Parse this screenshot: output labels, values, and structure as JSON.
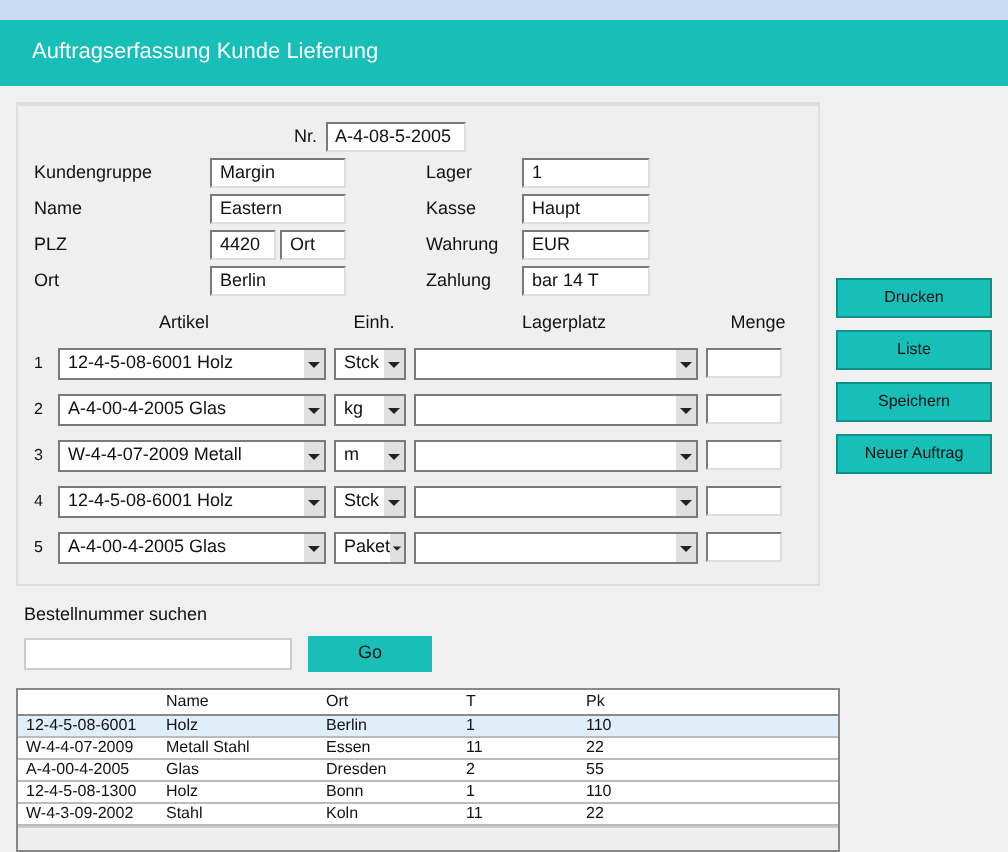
{
  "window": {
    "title": "Auftragserfassung Kunde Lieferung"
  },
  "order": {
    "label": "Nr.",
    "value": "A-4-08-5-2005"
  },
  "fields": [
    {
      "label": "Kundengruppe",
      "value": "Margin",
      "label_2": "Lager",
      "value_2": "1"
    },
    {
      "label": "Name",
      "value": "Eastern",
      "label_2": "Kasse",
      "value_2": "Haupt"
    },
    {
      "label": "PLZ",
      "value": "4420",
      "value_b": "Ort",
      "label_2": "Wahrung",
      "value_2": "EUR"
    },
    {
      "label": "Ort",
      "value": "Berlin",
      "label_2": "Zahlung",
      "value_2": "bar 14 T"
    }
  ],
  "line_headers": [
    "Artikel",
    "Einh.",
    "Lagerplatz",
    "Menge"
  ],
  "lines": [
    {
      "index": "1",
      "article": "12-4-5-08-6001",
      "article_2": "Holz",
      "unit": "Stck"
    },
    {
      "index": "2",
      "article": "A-4-00-4-2005",
      "article_2": "Glas",
      "unit": "kg"
    },
    {
      "index": "3",
      "article": "W-4-4-07-2009",
      "article_2": "Metall",
      "unit": "m"
    },
    {
      "index": "4",
      "article": "12-4-5-08-6001",
      "article_2": "Holz",
      "unit": "Stck"
    },
    {
      "index": "5",
      "article": "A-4-00-4-2005",
      "article_2": "Glas",
      "unit": "Paket"
    }
  ],
  "buttons": [
    "Drucken",
    "Liste",
    "Speichern",
    "Neuer Auftrag"
  ],
  "search": {
    "label": "Bestellnummer suchen"
  },
  "search_button": "Go",
  "table": {
    "columns": [
      null,
      "Name",
      "Ort",
      "T",
      "Pk"
    ],
    "rows": [
      {
        "selected": true,
        "cells": [
          "12-4-5-08-6001",
          "Holz",
          "Berlin",
          "1",
          "110"
        ]
      },
      {
        "selected": false,
        "cells": [
          "W-4-4-07-2009",
          "Metall Stahl",
          "Essen",
          "11",
          "22"
        ]
      },
      {
        "selected": false,
        "cells": [
          "A-4-00-4-2005",
          "Glas",
          "Dresden",
          "2",
          "55"
        ]
      },
      {
        "selected": false,
        "cells": [
          "12-4-5-08-1300",
          "Holz",
          "Bonn",
          "1",
          "110"
        ]
      },
      {
        "selected": false,
        "cells": [
          "W-4-3-09-2002",
          "Stahl",
          "Koln",
          "11",
          "22"
        ]
      }
    ]
  }
}
